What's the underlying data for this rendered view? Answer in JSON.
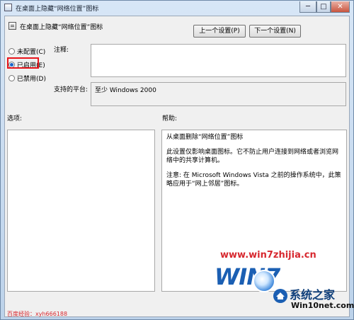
{
  "window": {
    "title": "在桌面上隐藏“网络位置”图标",
    "minimize": "─",
    "maximize": "□",
    "close": "✕"
  },
  "setting": {
    "name": "在桌面上隐藏“网络位置”图标"
  },
  "nav": {
    "prev": "上一个设置(P)",
    "next": "下一个设置(N)"
  },
  "options": [
    {
      "label": "未配置(C)",
      "checked": false
    },
    {
      "label": "已启用(E)",
      "checked": true
    },
    {
      "label": "已禁用(D)",
      "checked": false
    }
  ],
  "comment": {
    "label": "注释:",
    "value": ""
  },
  "platform": {
    "label": "支持的平台:",
    "value": "至少 Windows 2000"
  },
  "sections": {
    "options_label": "选项:",
    "help_label": "帮助:"
  },
  "help": {
    "lines": [
      "从桌面删除“网络位置”图标",
      "此设置仅影响桌面图标。它不防止用户连接到网络或者浏览网络中的共享计算机。",
      "注意: 在 Microsoft Windows Vista 之前的操作系统中，此策略应用于“网上邻居”图标。"
    ]
  },
  "overlays": {
    "watermark_url": "www.win7zhijia.cn",
    "logo_word": "WIN7",
    "brand_main": "系统之家",
    "brand_sub": "Win10net.com",
    "footer_note": "百度经验：xyh666188"
  },
  "colors": {
    "highlight": "#e8161c",
    "watermark": "#d7282f",
    "accent": "#1c64c8"
  }
}
